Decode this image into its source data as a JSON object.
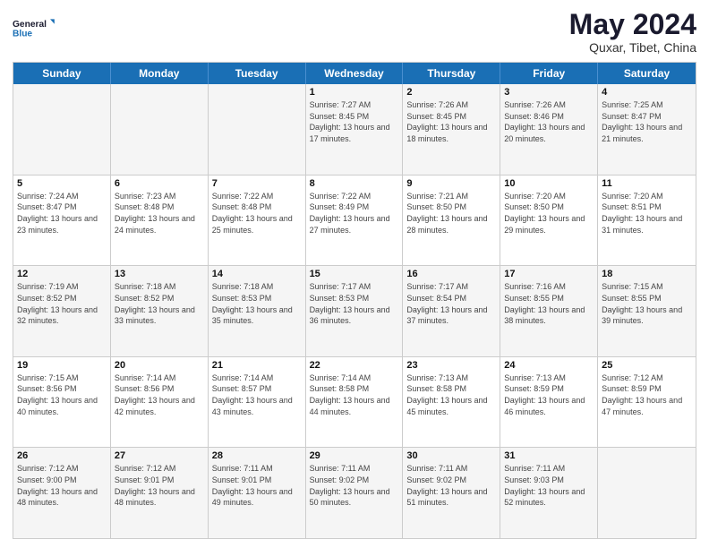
{
  "header": {
    "logo_line1": "General",
    "logo_line2": "Blue",
    "title": "May 2024",
    "subtitle": "Quxar, Tibet, China"
  },
  "days_of_week": [
    "Sunday",
    "Monday",
    "Tuesday",
    "Wednesday",
    "Thursday",
    "Friday",
    "Saturday"
  ],
  "weeks": [
    [
      {
        "day": "",
        "info": ""
      },
      {
        "day": "",
        "info": ""
      },
      {
        "day": "",
        "info": ""
      },
      {
        "day": "1",
        "info": "Sunrise: 7:27 AM\nSunset: 8:45 PM\nDaylight: 13 hours and 17 minutes."
      },
      {
        "day": "2",
        "info": "Sunrise: 7:26 AM\nSunset: 8:45 PM\nDaylight: 13 hours and 18 minutes."
      },
      {
        "day": "3",
        "info": "Sunrise: 7:26 AM\nSunset: 8:46 PM\nDaylight: 13 hours and 20 minutes."
      },
      {
        "day": "4",
        "info": "Sunrise: 7:25 AM\nSunset: 8:47 PM\nDaylight: 13 hours and 21 minutes."
      }
    ],
    [
      {
        "day": "5",
        "info": "Sunrise: 7:24 AM\nSunset: 8:47 PM\nDaylight: 13 hours and 23 minutes."
      },
      {
        "day": "6",
        "info": "Sunrise: 7:23 AM\nSunset: 8:48 PM\nDaylight: 13 hours and 24 minutes."
      },
      {
        "day": "7",
        "info": "Sunrise: 7:22 AM\nSunset: 8:48 PM\nDaylight: 13 hours and 25 minutes."
      },
      {
        "day": "8",
        "info": "Sunrise: 7:22 AM\nSunset: 8:49 PM\nDaylight: 13 hours and 27 minutes."
      },
      {
        "day": "9",
        "info": "Sunrise: 7:21 AM\nSunset: 8:50 PM\nDaylight: 13 hours and 28 minutes."
      },
      {
        "day": "10",
        "info": "Sunrise: 7:20 AM\nSunset: 8:50 PM\nDaylight: 13 hours and 29 minutes."
      },
      {
        "day": "11",
        "info": "Sunrise: 7:20 AM\nSunset: 8:51 PM\nDaylight: 13 hours and 31 minutes."
      }
    ],
    [
      {
        "day": "12",
        "info": "Sunrise: 7:19 AM\nSunset: 8:52 PM\nDaylight: 13 hours and 32 minutes."
      },
      {
        "day": "13",
        "info": "Sunrise: 7:18 AM\nSunset: 8:52 PM\nDaylight: 13 hours and 33 minutes."
      },
      {
        "day": "14",
        "info": "Sunrise: 7:18 AM\nSunset: 8:53 PM\nDaylight: 13 hours and 35 minutes."
      },
      {
        "day": "15",
        "info": "Sunrise: 7:17 AM\nSunset: 8:53 PM\nDaylight: 13 hours and 36 minutes."
      },
      {
        "day": "16",
        "info": "Sunrise: 7:17 AM\nSunset: 8:54 PM\nDaylight: 13 hours and 37 minutes."
      },
      {
        "day": "17",
        "info": "Sunrise: 7:16 AM\nSunset: 8:55 PM\nDaylight: 13 hours and 38 minutes."
      },
      {
        "day": "18",
        "info": "Sunrise: 7:15 AM\nSunset: 8:55 PM\nDaylight: 13 hours and 39 minutes."
      }
    ],
    [
      {
        "day": "19",
        "info": "Sunrise: 7:15 AM\nSunset: 8:56 PM\nDaylight: 13 hours and 40 minutes."
      },
      {
        "day": "20",
        "info": "Sunrise: 7:14 AM\nSunset: 8:56 PM\nDaylight: 13 hours and 42 minutes."
      },
      {
        "day": "21",
        "info": "Sunrise: 7:14 AM\nSunset: 8:57 PM\nDaylight: 13 hours and 43 minutes."
      },
      {
        "day": "22",
        "info": "Sunrise: 7:14 AM\nSunset: 8:58 PM\nDaylight: 13 hours and 44 minutes."
      },
      {
        "day": "23",
        "info": "Sunrise: 7:13 AM\nSunset: 8:58 PM\nDaylight: 13 hours and 45 minutes."
      },
      {
        "day": "24",
        "info": "Sunrise: 7:13 AM\nSunset: 8:59 PM\nDaylight: 13 hours and 46 minutes."
      },
      {
        "day": "25",
        "info": "Sunrise: 7:12 AM\nSunset: 8:59 PM\nDaylight: 13 hours and 47 minutes."
      }
    ],
    [
      {
        "day": "26",
        "info": "Sunrise: 7:12 AM\nSunset: 9:00 PM\nDaylight: 13 hours and 48 minutes."
      },
      {
        "day": "27",
        "info": "Sunrise: 7:12 AM\nSunset: 9:01 PM\nDaylight: 13 hours and 48 minutes."
      },
      {
        "day": "28",
        "info": "Sunrise: 7:11 AM\nSunset: 9:01 PM\nDaylight: 13 hours and 49 minutes."
      },
      {
        "day": "29",
        "info": "Sunrise: 7:11 AM\nSunset: 9:02 PM\nDaylight: 13 hours and 50 minutes."
      },
      {
        "day": "30",
        "info": "Sunrise: 7:11 AM\nSunset: 9:02 PM\nDaylight: 13 hours and 51 minutes."
      },
      {
        "day": "31",
        "info": "Sunrise: 7:11 AM\nSunset: 9:03 PM\nDaylight: 13 hours and 52 minutes."
      },
      {
        "day": "",
        "info": ""
      }
    ]
  ],
  "alt_rows": [
    0,
    2,
    4
  ]
}
